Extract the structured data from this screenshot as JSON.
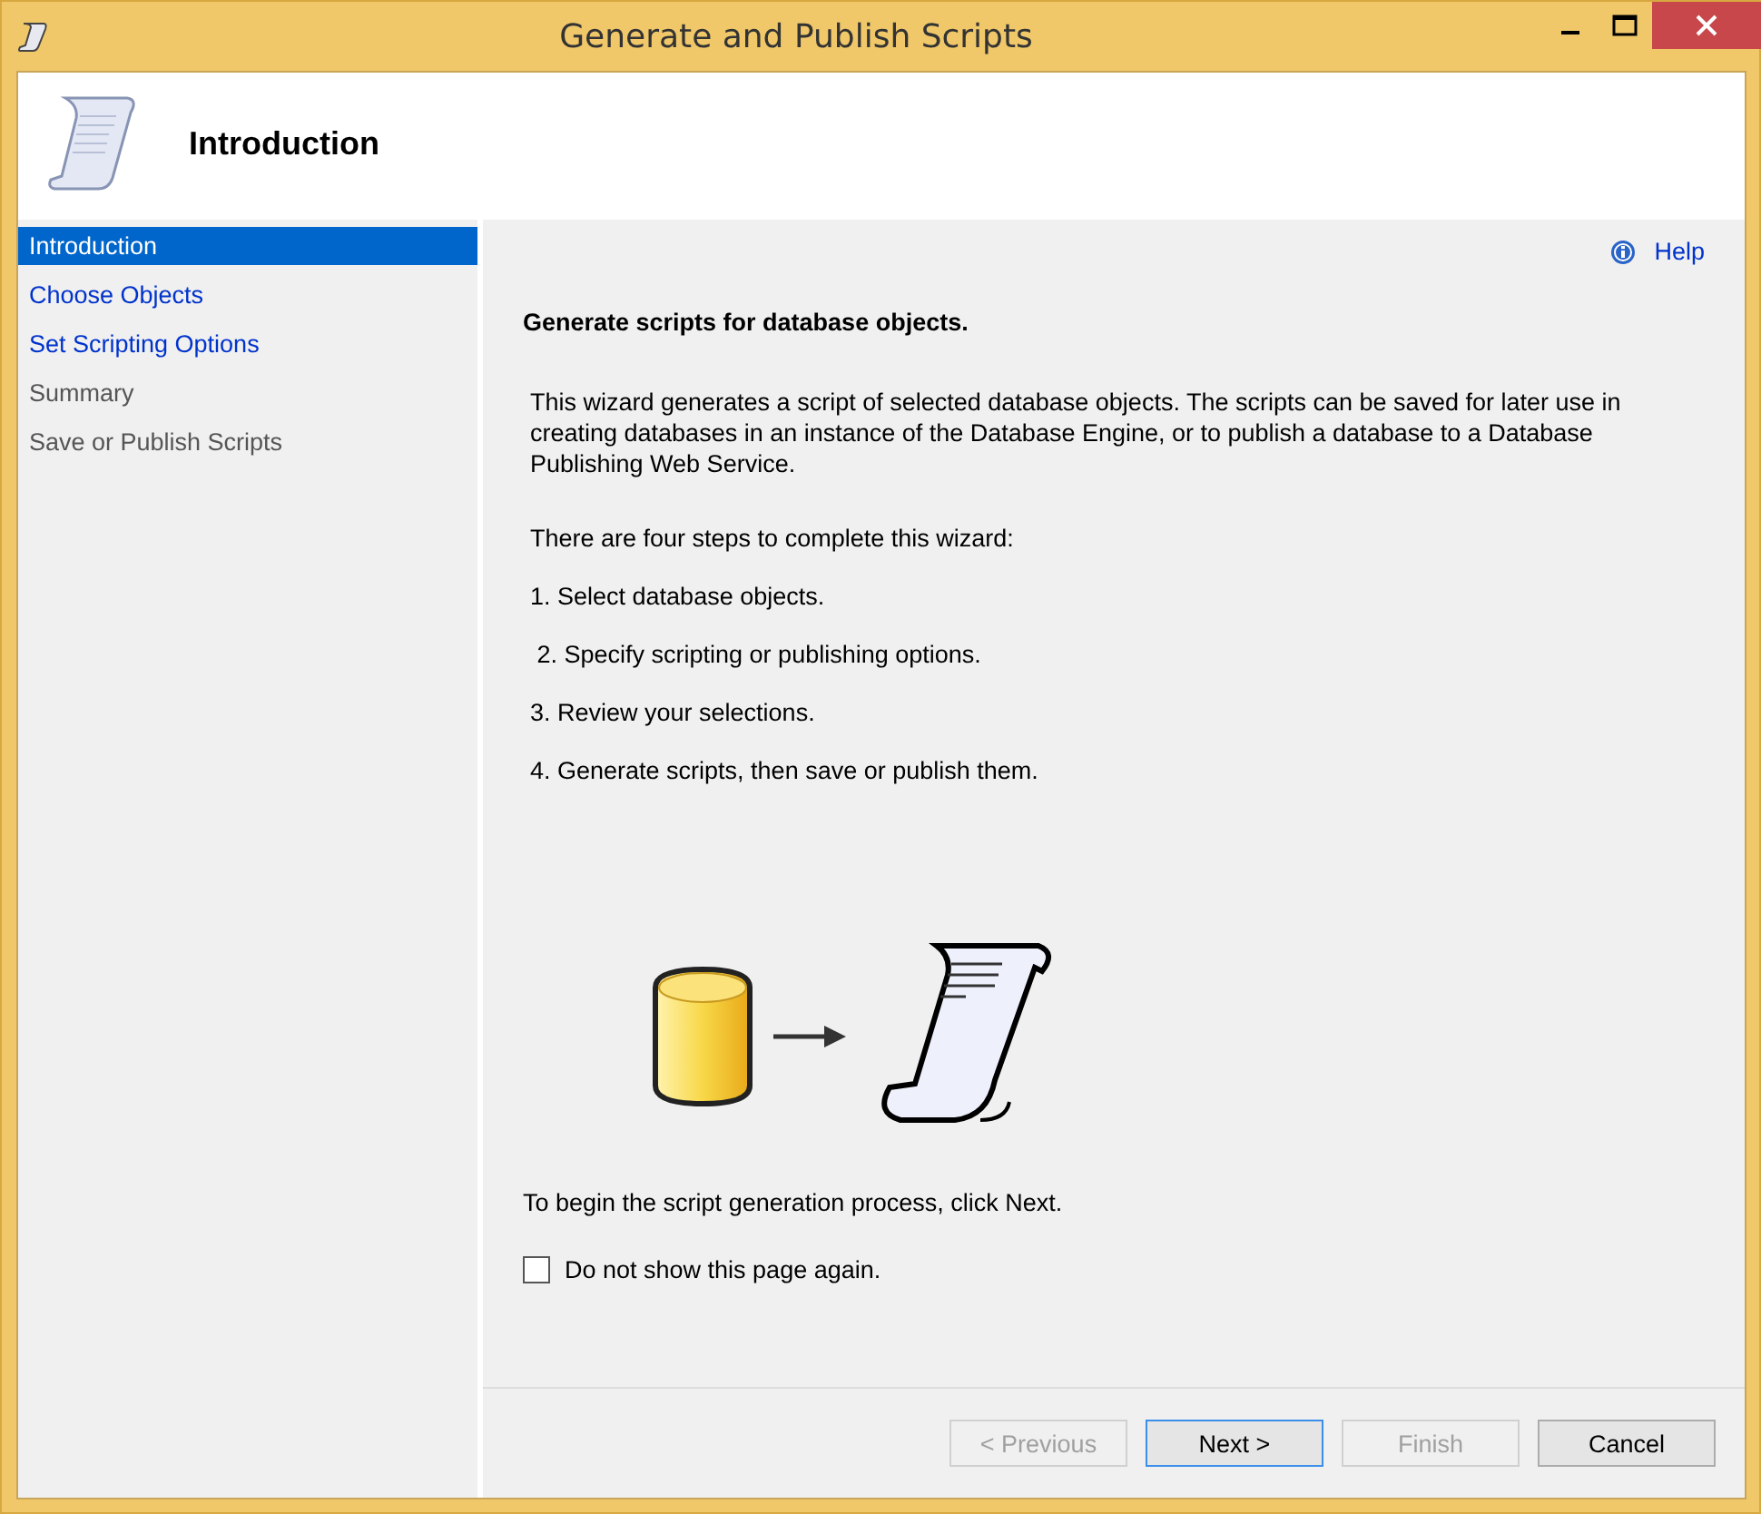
{
  "window": {
    "title": "Generate and Publish Scripts"
  },
  "header": {
    "title": "Introduction"
  },
  "sidebar": {
    "items": [
      {
        "label": "Introduction",
        "selected": true,
        "disabled": false
      },
      {
        "label": "Choose Objects",
        "selected": false,
        "disabled": false
      },
      {
        "label": "Set Scripting Options",
        "selected": false,
        "disabled": false
      },
      {
        "label": "Summary",
        "selected": false,
        "disabled": true
      },
      {
        "label": "Save or Publish Scripts",
        "selected": false,
        "disabled": true
      }
    ]
  },
  "help": {
    "label": "Help"
  },
  "content": {
    "heading": "Generate scripts for database objects.",
    "description": "This wizard generates a script of selected database objects. The scripts can be saved for later use in creating databases in an instance of the Database Engine, or to publish a database to a Database Publishing Web Service.",
    "steps_intro": "There are four steps to complete this wizard:",
    "steps": [
      "1. Select database objects.",
      " 2. Specify scripting or publishing options.",
      "3. Review your selections.",
      "4. Generate scripts, then save or publish them."
    ],
    "begin": "To begin the script generation process, click Next.",
    "dont_show": {
      "label": "Do not show this page again.",
      "checked": false
    }
  },
  "buttons": [
    {
      "label": "< Previous",
      "disabled": true,
      "default": false
    },
    {
      "label": "Next >",
      "disabled": false,
      "default": true
    },
    {
      "label": "Finish",
      "disabled": true,
      "default": false
    },
    {
      "label": "Cancel",
      "disabled": false,
      "default": false
    }
  ]
}
